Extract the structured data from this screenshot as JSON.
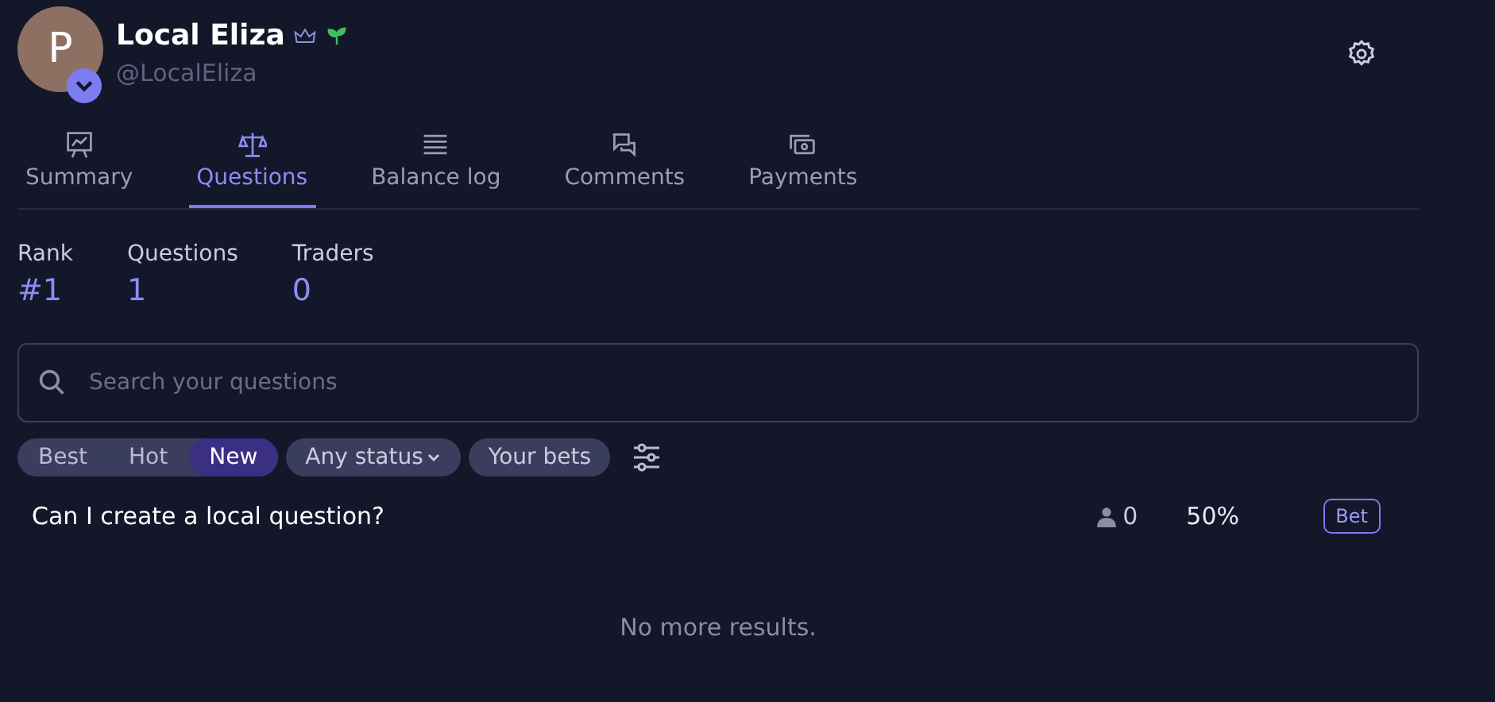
{
  "profile": {
    "avatar_letter": "P",
    "name": "Local Eliza",
    "username": "@LocalEliza"
  },
  "tabs": [
    {
      "label": "Summary",
      "kind": "chart",
      "selected": false
    },
    {
      "label": "Questions",
      "kind": "scale",
      "selected": true
    },
    {
      "label": "Balance log",
      "kind": "lines",
      "selected": false
    },
    {
      "label": "Comments",
      "kind": "chat",
      "selected": false
    },
    {
      "label": "Payments",
      "kind": "money",
      "selected": false
    }
  ],
  "stats": [
    {
      "label": "Rank",
      "value": "#1"
    },
    {
      "label": "Questions",
      "value": "1"
    },
    {
      "label": "Traders",
      "value": "0"
    }
  ],
  "search": {
    "placeholder": "Search your questions"
  },
  "sort": [
    {
      "label": "Best",
      "selected": false
    },
    {
      "label": "Hot",
      "selected": false
    },
    {
      "label": "New",
      "selected": true
    }
  ],
  "filters": [
    {
      "label": "Any status",
      "dropdown": true
    },
    {
      "label": "Your bets",
      "dropdown": false
    }
  ],
  "questions": [
    {
      "title": "Can I create a local question?",
      "traders": "0",
      "probability": "50%",
      "action": "Bet"
    }
  ],
  "footer": "No more results."
}
